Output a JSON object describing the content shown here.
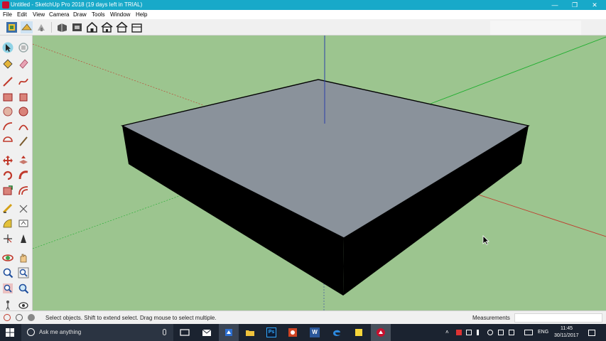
{
  "window": {
    "title": "Untitled - SketchUp Pro 2018 (19 days left in TRIAL)",
    "controls": {
      "minimize": "—",
      "restore": "❐",
      "close": "✕"
    }
  },
  "menu": [
    "File",
    "Edit",
    "View",
    "Camera",
    "Draw",
    "Tools",
    "Window",
    "Help"
  ],
  "toolbar": {
    "buttons": [
      "components-icon",
      "paint-icon",
      "share-icon",
      "3d-warehouse-icon",
      "extension-warehouse-icon",
      "iso-view-icon",
      "home-view-icon",
      "front-house-icon",
      "back-house-icon"
    ]
  },
  "left_toolbar": {
    "tools": [
      "select-icon",
      "component-icon",
      "paint-bucket-icon",
      "eraser-icon",
      "line-icon",
      "freehand-icon",
      "rectangle-icon",
      "rotated-rectangle-icon",
      "circle-icon",
      "polygon-icon",
      "arc-icon",
      "two-point-arc-icon",
      "pie-icon",
      "three-point-arc-icon",
      "move-icon",
      "push-pull-icon",
      "rotate-icon",
      "follow-me-icon",
      "scale-icon",
      "offset-icon",
      "tape-measure-icon",
      "dimension-icon",
      "protractor-icon",
      "text-icon",
      "axes-icon",
      "3d-text-icon",
      "orbit-icon",
      "pan-icon",
      "zoom-icon",
      "zoom-window-icon",
      "zoom-extents-icon",
      "previous-view-icon",
      "walk-icon",
      "look-around-icon"
    ]
  },
  "colors": {
    "titlebar": "#18a9c9",
    "viewport_bg": "#9cc58f",
    "box_top": "#8a929b",
    "box_side": "#000000",
    "axis_red": "#c0392b",
    "axis_green": "#1fae2f",
    "axis_blue": "#2c3fa8"
  },
  "status": {
    "hint": "Select objects. Shift to extend select. Drag mouse to select multiple.",
    "measurements_label": "Measurements",
    "measurements_value": ""
  },
  "taskbar": {
    "search_placeholder": "Ask me anything",
    "apps": [
      "task-view-icon",
      "mail-icon",
      "sketchup-taskbar-icon",
      "file-explorer-icon",
      "photoshop-icon",
      "powerpoint-icon",
      "word-icon",
      "edge-icon",
      "sticky-notes-icon",
      "sketchup-active-icon"
    ],
    "ps_label": "Ps",
    "word_label": "W",
    "language": "ENG",
    "time": "11:45",
    "date": "30/11/2017"
  }
}
